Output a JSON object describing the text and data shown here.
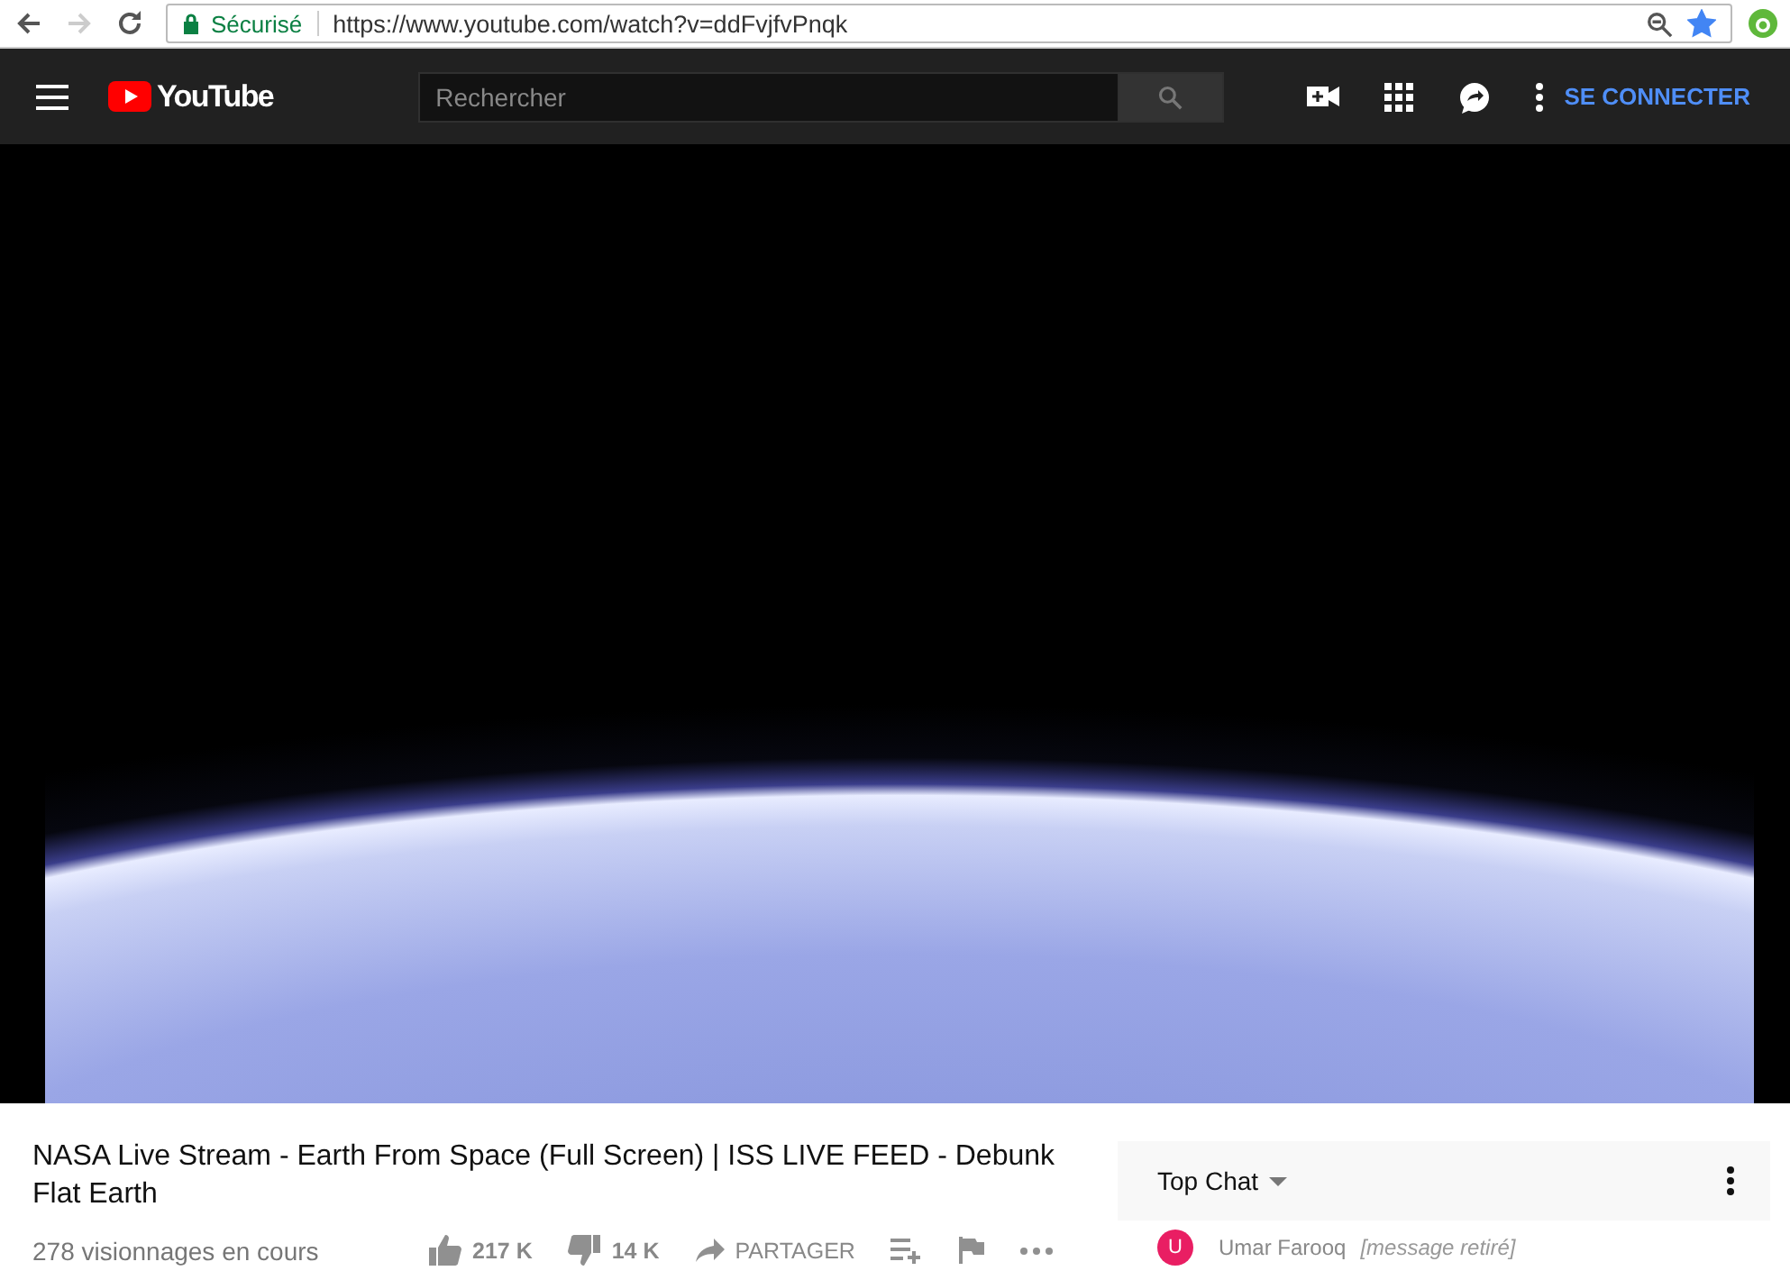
{
  "browser": {
    "security_label": "Sécurisé",
    "url": "https://www.youtube.com/watch?v=ddFvjfvPnqk",
    "bookmarked": true
  },
  "header": {
    "logo": "YouTube",
    "search": {
      "placeholder": "Rechercher"
    },
    "sign_in": "SE CONNECTER"
  },
  "video": {
    "title": "NASA Live Stream - Earth From Space (Full Screen) | ISS LIVE FEED - Debunk Flat Earth",
    "views": "278 visionnages en cours",
    "likes": "217 K",
    "dislikes": "14 K",
    "share": "PARTAGER"
  },
  "chat": {
    "header": "Top Chat",
    "messages": [
      {
        "author": "Umar Farooq",
        "avatar": "U",
        "color": "#e91e63",
        "message": "[message retiré]"
      }
    ]
  }
}
